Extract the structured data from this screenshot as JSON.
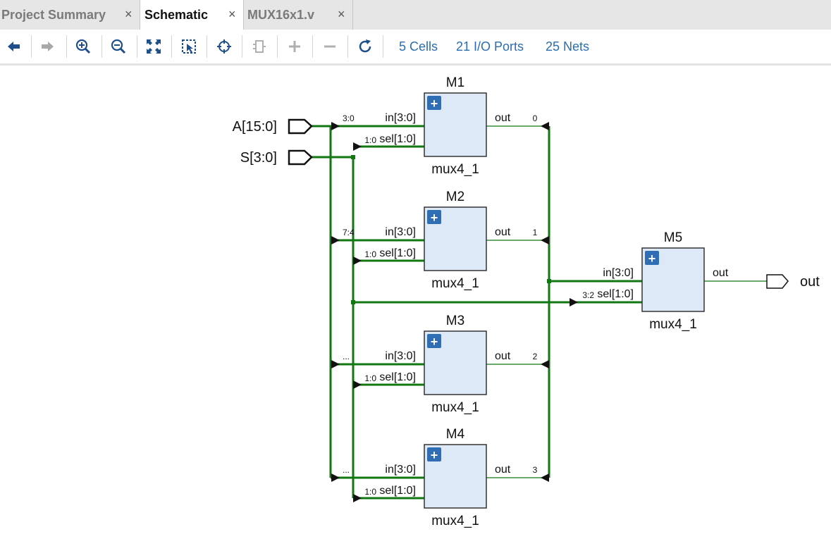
{
  "tabs": [
    {
      "label": "Project Summary",
      "active": false
    },
    {
      "label": "Schematic",
      "active": true
    },
    {
      "label": "MUX16x1.v",
      "active": false
    }
  ],
  "tab_close_glyph": "×",
  "toolbar": {
    "icons": [
      "back-arrow-icon",
      "forward-arrow-icon",
      "zoom-in-icon",
      "zoom-out-icon",
      "zoom-fit-icon",
      "auto-fit-selection-icon",
      "select-area-icon",
      "collapse-cell-icon",
      "expand-plus-icon",
      "collapse-minus-icon",
      "refresh-icon"
    ],
    "stats": [
      "5 Cells",
      "21 I/O Ports",
      "25 Nets"
    ]
  },
  "schematic": {
    "input_ports": [
      "A[15:0]",
      "S[3:0]"
    ],
    "output_port": "out",
    "cells": [
      {
        "name": "M1",
        "type": "mux4_1",
        "in_pin": "in[3:0]",
        "sel_pin": "sel[1:0]",
        "out_pin": "out",
        "in_slice": "3:0",
        "sel_slice": "1:0",
        "out_bit": "0"
      },
      {
        "name": "M2",
        "type": "mux4_1",
        "in_pin": "in[3:0]",
        "sel_pin": "sel[1:0]",
        "out_pin": "out",
        "in_slice": "7:4",
        "sel_slice": "1:0",
        "out_bit": "1"
      },
      {
        "name": "M3",
        "type": "mux4_1",
        "in_pin": "in[3:0]",
        "sel_pin": "sel[1:0]",
        "out_pin": "out",
        "in_slice": "...",
        "sel_slice": "1:0",
        "out_bit": "2"
      },
      {
        "name": "M4",
        "type": "mux4_1",
        "in_pin": "in[3:0]",
        "sel_pin": "sel[1:0]",
        "out_pin": "out",
        "in_slice": "...",
        "sel_slice": "1:0",
        "out_bit": "3"
      },
      {
        "name": "M5",
        "type": "mux4_1",
        "in_pin": "in[3:0]",
        "sel_pin": "sel[1:0]",
        "out_pin": "out",
        "in_slice": "",
        "sel_slice": "3:2",
        "out_bit": ""
      }
    ],
    "cell_expand_glyph": "+",
    "colors": {
      "wire": "#117711",
      "cell_fill": "#dde9f7",
      "cell_border": "#333333",
      "link": "#2a6db0",
      "expand_btn": "#2f6eb5"
    }
  }
}
